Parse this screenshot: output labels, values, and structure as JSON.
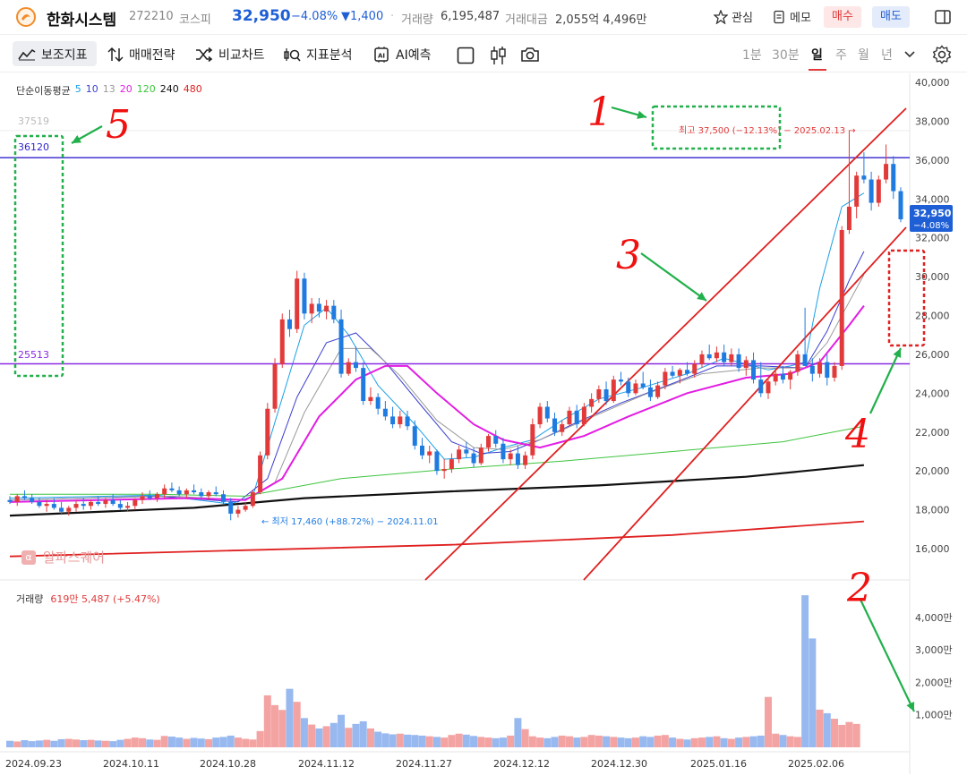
{
  "header": {
    "name": "한화시스템",
    "code": "272210",
    "market": "코스피",
    "price": "32,950",
    "change_pct": "−4.08%",
    "change": "▼1,400",
    "volume_label": "거래량",
    "volume": "6,195,487",
    "amount_label": "거래대금",
    "amount": "2,055억 4,496만",
    "favorite_label": "관심",
    "memo_label": "메모",
    "buy_label": "매수",
    "sell_label": "매도"
  },
  "toolbar": {
    "tools": [
      "보조지표",
      "매매전략",
      "비교차트",
      "지표분석",
      "AI예측"
    ],
    "periods": [
      "1분",
      "30분",
      "일",
      "주",
      "월",
      "년"
    ],
    "selected_period": "일"
  },
  "ma_legend": {
    "title": "단순이동평균",
    "items": [
      {
        "label": "5",
        "color": "#1aa0e6"
      },
      {
        "label": "10",
        "color": "#3b3fd0"
      },
      {
        "label": "13",
        "color": "#9a9a9a"
      },
      {
        "label": "20",
        "color": "#e21de2"
      },
      {
        "label": "120",
        "color": "#3ec43e"
      },
      {
        "label": "240",
        "color": "#111111"
      },
      {
        "label": "480",
        "color": "#e02020"
      }
    ]
  },
  "volume_legend": {
    "title": "거래량",
    "value": "619만 5,487 (+5.47%)"
  },
  "watermark": "알파스퀘어",
  "annotations": {
    "high": "최고 37,500 (−12.13%) − 2025.02.13 →",
    "low": "← 최저 17,460 (+88.72%) − 2024.11.01",
    "level_top": "36120",
    "level_bottom": "25513",
    "level_faint": "37519",
    "price_tag_value": "32,950",
    "price_tag_pct": "−4.08%",
    "hand_labels": [
      "1",
      "2",
      "3",
      "4",
      "5"
    ]
  },
  "chart_data": {
    "type": "candlestick",
    "price_axis": {
      "ticks": [
        "40,000",
        "38,000",
        "36,000",
        "34,000",
        "32,000",
        "30,000",
        "28,000",
        "26,000",
        "24,000",
        "22,000",
        "20,000",
        "18,000",
        "16,000"
      ],
      "ylim": [
        15000,
        40000
      ]
    },
    "volume_axis": {
      "ticks": [
        "4,000만",
        "3,000만",
        "2,000만",
        "1,000만"
      ]
    },
    "x_ticks": [
      "2024.09.23",
      "2024.10.11",
      "2024.10.28",
      "2024.11.12",
      "2024.11.27",
      "2024.12.12",
      "2024.12.30",
      "2025.01.16",
      "2025.02.06"
    ],
    "horizontal_levels": [
      36120,
      25513
    ],
    "candles": [
      [
        18500,
        18700,
        18300,
        18400
      ],
      [
        18400,
        18800,
        18200,
        18700
      ],
      [
        18700,
        19000,
        18500,
        18600
      ],
      [
        18600,
        18800,
        18300,
        18400
      ],
      [
        18400,
        18600,
        18100,
        18200
      ],
      [
        18200,
        18500,
        17900,
        18300
      ],
      [
        18300,
        18600,
        18000,
        18100
      ],
      [
        18100,
        18400,
        17800,
        17900
      ],
      [
        17900,
        18200,
        17700,
        18100
      ],
      [
        18100,
        18500,
        17900,
        18300
      ],
      [
        18300,
        18600,
        18000,
        18200
      ],
      [
        18200,
        18500,
        18000,
        18400
      ],
      [
        18400,
        18700,
        18200,
        18300
      ],
      [
        18300,
        18600,
        18100,
        18500
      ],
      [
        18500,
        18800,
        18200,
        18300
      ],
      [
        18300,
        18500,
        18000,
        18100
      ],
      [
        18100,
        18400,
        17900,
        18200
      ],
      [
        18200,
        18600,
        18000,
        18500
      ],
      [
        18500,
        18900,
        18300,
        18700
      ],
      [
        18700,
        19000,
        18500,
        18600
      ],
      [
        18600,
        18900,
        18400,
        18800
      ],
      [
        18800,
        19300,
        18600,
        19100
      ],
      [
        19100,
        19400,
        18900,
        19000
      ],
      [
        19000,
        19200,
        18700,
        18800
      ],
      [
        18800,
        19100,
        18600,
        19000
      ],
      [
        19000,
        19300,
        18800,
        18900
      ],
      [
        18900,
        19100,
        18600,
        18700
      ],
      [
        18700,
        19000,
        18500,
        18900
      ],
      [
        18900,
        19200,
        18700,
        18800
      ],
      [
        18800,
        19000,
        18300,
        18400
      ],
      [
        18400,
        18600,
        17460,
        17800
      ],
      [
        17800,
        18200,
        17600,
        18000
      ],
      [
        18000,
        18400,
        17900,
        18200
      ],
      [
        18200,
        19000,
        18100,
        18900
      ],
      [
        18900,
        21000,
        18800,
        20800
      ],
      [
        20800,
        23500,
        20600,
        23200
      ],
      [
        23200,
        25800,
        23000,
        25500
      ],
      [
        25500,
        28100,
        25300,
        27800
      ],
      [
        27800,
        28300,
        26900,
        27300
      ],
      [
        27300,
        30300,
        27100,
        29900
      ],
      [
        29900,
        30200,
        27800,
        28100
      ],
      [
        28100,
        28900,
        27600,
        28600
      ],
      [
        28600,
        28900,
        27900,
        28200
      ],
      [
        28200,
        28800,
        27800,
        28500
      ],
      [
        28500,
        28800,
        27600,
        27800
      ],
      [
        27800,
        28300,
        24800,
        25000
      ],
      [
        25000,
        25800,
        24900,
        25600
      ],
      [
        25600,
        26400,
        25100,
        25300
      ],
      [
        25300,
        25600,
        23400,
        23600
      ],
      [
        23600,
        24300,
        23400,
        23800
      ],
      [
        23800,
        24000,
        22900,
        23200
      ],
      [
        23200,
        23600,
        22600,
        22800
      ],
      [
        22800,
        23300,
        22200,
        22400
      ],
      [
        22400,
        23100,
        22200,
        22800
      ],
      [
        22800,
        23100,
        22100,
        22300
      ],
      [
        22300,
        22600,
        21100,
        21300
      ],
      [
        21300,
        21700,
        20600,
        20800
      ],
      [
        20800,
        21300,
        20400,
        21000
      ],
      [
        21000,
        21100,
        19800,
        20000
      ],
      [
        20000,
        20600,
        19600,
        20100
      ],
      [
        20100,
        20900,
        19900,
        20600
      ],
      [
        20600,
        21300,
        20400,
        21100
      ],
      [
        21100,
        21500,
        20700,
        20900
      ],
      [
        20900,
        21200,
        20200,
        20400
      ],
      [
        20400,
        21400,
        20300,
        21200
      ],
      [
        21200,
        21900,
        21000,
        21800
      ],
      [
        21800,
        22100,
        21200,
        21400
      ],
      [
        21400,
        21700,
        20400,
        20600
      ],
      [
        20600,
        21100,
        20300,
        20900
      ],
      [
        20900,
        21300,
        20100,
        20300
      ],
      [
        20300,
        21000,
        20100,
        20800
      ],
      [
        20800,
        22700,
        20600,
        22400
      ],
      [
        22400,
        23500,
        22200,
        23300
      ],
      [
        23300,
        23600,
        22500,
        22700
      ],
      [
        22700,
        23000,
        21800,
        22000
      ],
      [
        22000,
        22600,
        21800,
        22400
      ],
      [
        22400,
        23300,
        22300,
        23100
      ],
      [
        23100,
        23400,
        22200,
        22400
      ],
      [
        22400,
        23500,
        22300,
        23300
      ],
      [
        23300,
        24000,
        23000,
        23700
      ],
      [
        23700,
        24400,
        23500,
        24200
      ],
      [
        24200,
        24600,
        23400,
        23600
      ],
      [
        23600,
        24900,
        23500,
        24700
      ],
      [
        24700,
        25100,
        24400,
        24600
      ],
      [
        24600,
        24800,
        23800,
        24000
      ],
      [
        24000,
        24700,
        23900,
        24500
      ],
      [
        24500,
        25100,
        24200,
        24300
      ],
      [
        24300,
        24700,
        23600,
        23800
      ],
      [
        23800,
        24600,
        23700,
        24400
      ],
      [
        24400,
        25300,
        24200,
        25100
      ],
      [
        25100,
        25400,
        24800,
        24900
      ],
      [
        24900,
        25300,
        24500,
        25200
      ],
      [
        25200,
        25600,
        24900,
        25000
      ],
      [
        25000,
        25700,
        24800,
        25500
      ],
      [
        25500,
        26200,
        25300,
        26000
      ],
      [
        26000,
        26500,
        25700,
        25800
      ],
      [
        25800,
        26400,
        25600,
        26100
      ],
      [
        26100,
        26500,
        25400,
        25600
      ],
      [
        25600,
        26300,
        25400,
        26000
      ],
      [
        26000,
        26300,
        25100,
        25300
      ],
      [
        25300,
        25900,
        24900,
        25700
      ],
      [
        25700,
        26100,
        24500,
        24700
      ],
      [
        24700,
        25600,
        23800,
        24000
      ],
      [
        24000,
        24800,
        23700,
        24600
      ],
      [
        24600,
        25200,
        24400,
        25000
      ],
      [
        25000,
        25400,
        24500,
        24700
      ],
      [
        24700,
        25200,
        24200,
        25100
      ],
      [
        25100,
        26200,
        24900,
        26000
      ],
      [
        26000,
        28400,
        25800,
        25400
      ],
      [
        25400,
        25800,
        24600,
        25000
      ],
      [
        25000,
        25800,
        24800,
        25600
      ],
      [
        25600,
        26000,
        24400,
        24800
      ],
      [
        24800,
        25600,
        24600,
        25400
      ],
      [
        25400,
        32600,
        25200,
        32400
      ],
      [
        32400,
        37500,
        32200,
        33600
      ],
      [
        33600,
        35400,
        33000,
        35200
      ],
      [
        35200,
        36400,
        34800,
        35000
      ],
      [
        35000,
        35400,
        33400,
        33800
      ],
      [
        33800,
        35200,
        33600,
        35000
      ],
      [
        35000,
        36800,
        34800,
        35800
      ],
      [
        35800,
        36200,
        34000,
        34400
      ],
      [
        34400,
        34600,
        32800,
        32950
      ]
    ],
    "volume": [
      200,
      180,
      220,
      190,
      210,
      230,
      200,
      250,
      260,
      240,
      220,
      230,
      210,
      200,
      190,
      230,
      260,
      300,
      280,
      240,
      230,
      350,
      330,
      300,
      260,
      290,
      270,
      250,
      300,
      320,
      360,
      300,
      260,
      240,
      500,
      1600,
      1300,
      1150,
      1800,
      1400,
      900,
      700,
      580,
      650,
      750,
      1000,
      600,
      720,
      800,
      580,
      480,
      430,
      400,
      420,
      390,
      380,
      360,
      340,
      320,
      300,
      380,
      420,
      390,
      350,
      320,
      300,
      280,
      300,
      360,
      900,
      560,
      340,
      300,
      280,
      320,
      360,
      340,
      300,
      320,
      380,
      360,
      340,
      320,
      300,
      280,
      300,
      340,
      320,
      360,
      380,
      300,
      260,
      240,
      280,
      300,
      320,
      340,
      280,
      260,
      300,
      320,
      340,
      360,
      1550,
      420,
      380,
      340,
      320,
      4680,
      3350,
      1160,
      1050,
      880,
      690,
      780,
      720
    ],
    "ma_lines": {
      "ma5": [
        [
          0,
          18600
        ],
        [
          20,
          18750
        ],
        [
          30,
          18300
        ],
        [
          33,
          18700
        ],
        [
          36,
          22500
        ],
        [
          40,
          27500
        ],
        [
          43,
          28400
        ],
        [
          46,
          27000
        ],
        [
          50,
          24400
        ],
        [
          55,
          22400
        ],
        [
          59,
          20600
        ],
        [
          63,
          20700
        ],
        [
          67,
          21200
        ],
        [
          71,
          21600
        ],
        [
          75,
          22600
        ],
        [
          80,
          23700
        ],
        [
          86,
          24300
        ],
        [
          92,
          25000
        ],
        [
          97,
          25800
        ],
        [
          103,
          25200
        ],
        [
          106,
          25400
        ],
        [
          108,
          25600
        ],
        [
          110,
          29400
        ],
        [
          113,
          33600
        ],
        [
          116,
          34300
        ]
      ],
      "ma10": [
        [
          0,
          18500
        ],
        [
          20,
          18700
        ],
        [
          31,
          18400
        ],
        [
          35,
          19600
        ],
        [
          39,
          23800
        ],
        [
          43,
          26600
        ],
        [
          47,
          27100
        ],
        [
          51,
          25600
        ],
        [
          56,
          23300
        ],
        [
          60,
          21500
        ],
        [
          64,
          20900
        ],
        [
          68,
          21000
        ],
        [
          72,
          21600
        ],
        [
          77,
          22500
        ],
        [
          83,
          23500
        ],
        [
          90,
          24500
        ],
        [
          96,
          25400
        ],
        [
          102,
          25400
        ],
        [
          108,
          25300
        ],
        [
          111,
          27200
        ],
        [
          114,
          29800
        ],
        [
          116,
          31300
        ]
      ],
      "ma13": [
        [
          0,
          18500
        ],
        [
          22,
          18700
        ],
        [
          32,
          18500
        ],
        [
          36,
          19400
        ],
        [
          40,
          23000
        ],
        [
          45,
          26300
        ],
        [
          49,
          26300
        ],
        [
          53,
          24900
        ],
        [
          58,
          22600
        ],
        [
          63,
          21200
        ],
        [
          67,
          21100
        ],
        [
          72,
          21600
        ],
        [
          78,
          22600
        ],
        [
          86,
          23900
        ],
        [
          94,
          25000
        ],
        [
          102,
          25300
        ],
        [
          108,
          25300
        ],
        [
          111,
          26600
        ],
        [
          114,
          28700
        ],
        [
          116,
          30100
        ]
      ],
      "ma20": [
        [
          0,
          18400
        ],
        [
          24,
          18600
        ],
        [
          32,
          18500
        ],
        [
          37,
          19600
        ],
        [
          42,
          22800
        ],
        [
          47,
          24700
        ],
        [
          51,
          25400
        ],
        [
          54,
          25400
        ],
        [
          58,
          24000
        ],
        [
          63,
          22400
        ],
        [
          67,
          21600
        ],
        [
          72,
          21200
        ],
        [
          78,
          21800
        ],
        [
          84,
          22800
        ],
        [
          92,
          24000
        ],
        [
          100,
          24800
        ],
        [
          106,
          25000
        ],
        [
          110,
          25600
        ],
        [
          114,
          27500
        ],
        [
          116,
          28500
        ]
      ],
      "ma120": [
        [
          0,
          18800
        ],
        [
          20,
          18800
        ],
        [
          32,
          18700
        ],
        [
          45,
          19600
        ],
        [
          60,
          20100
        ],
        [
          75,
          20500
        ],
        [
          90,
          21000
        ],
        [
          105,
          21500
        ],
        [
          116,
          22300
        ]
      ],
      "ma240": [
        [
          0,
          17700
        ],
        [
          25,
          18100
        ],
        [
          40,
          18600
        ],
        [
          60,
          18950
        ],
        [
          80,
          19250
        ],
        [
          100,
          19700
        ],
        [
          116,
          20300
        ]
      ],
      "ma480": [
        [
          0,
          15600
        ],
        [
          30,
          15900
        ],
        [
          60,
          16200
        ],
        [
          90,
          16700
        ],
        [
          116,
          17400
        ]
      ]
    }
  }
}
